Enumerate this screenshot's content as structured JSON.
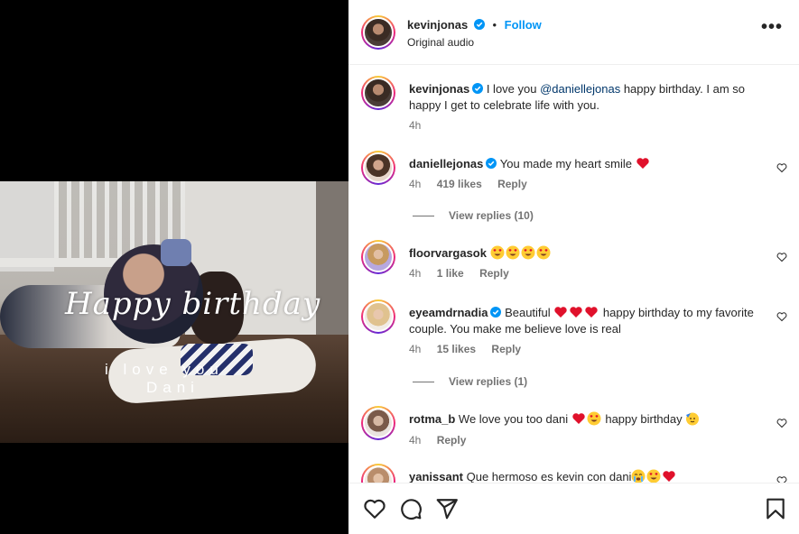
{
  "video": {
    "overlay_title": "Happy birthday",
    "overlay_line1": "i love you",
    "overlay_line2": "Dani"
  },
  "header": {
    "username": "kevinjonas",
    "separator": "•",
    "follow_label": "Follow",
    "audio": "Original audio",
    "more_label": "•••"
  },
  "caption": {
    "username": "kevinjonas",
    "text_before": "I love you",
    "mention": "@daniellejonas",
    "text_after": "happy birthday. I am so happy I get to celebrate life with you.",
    "time": "4h"
  },
  "comments": [
    {
      "username": "daniellejonas",
      "verified": true,
      "text": "You made my heart smile",
      "emojis": [
        "red-heart"
      ],
      "time": "4h",
      "likes": "419 likes",
      "reply_label": "Reply",
      "view_replies": "View replies (10)"
    },
    {
      "username": "floorvargasok",
      "verified": false,
      "text": "",
      "emojis": [
        "heart-eyes",
        "heart-eyes",
        "heart-eyes",
        "heart-eyes"
      ],
      "time": "4h",
      "likes": "1 like",
      "reply_label": "Reply"
    },
    {
      "username": "eyeamdrnadia",
      "verified": true,
      "text_before": "Beautiful",
      "text_after": "happy birthday to my favorite couple. You make me believe love is real",
      "emojis": [
        "red-heart",
        "red-heart",
        "red-heart"
      ],
      "time": "4h",
      "likes": "15 likes",
      "reply_label": "Reply",
      "view_replies": "View replies (1)"
    },
    {
      "username": "rotma_b",
      "verified": false,
      "text_before": "We love you too dani",
      "text_after": "happy birthday",
      "emojis": [
        "red-heart",
        "heart-eyes",
        "partying-face"
      ],
      "time": "4h",
      "reply_label": "Reply"
    },
    {
      "username": "yanissant",
      "verified": false,
      "text": "Que hermoso es kevin con dani",
      "emojis": [
        "crying-face",
        "heart-eyes",
        "red-heart"
      ]
    }
  ],
  "footer_icons": [
    "heart-icon",
    "comment-icon",
    "share-icon",
    "bookmark-icon"
  ],
  "colors": {
    "accent": "#0095f6",
    "text": "#262626",
    "muted": "#737373",
    "mention": "#00376b",
    "heart": "#ff3040"
  }
}
